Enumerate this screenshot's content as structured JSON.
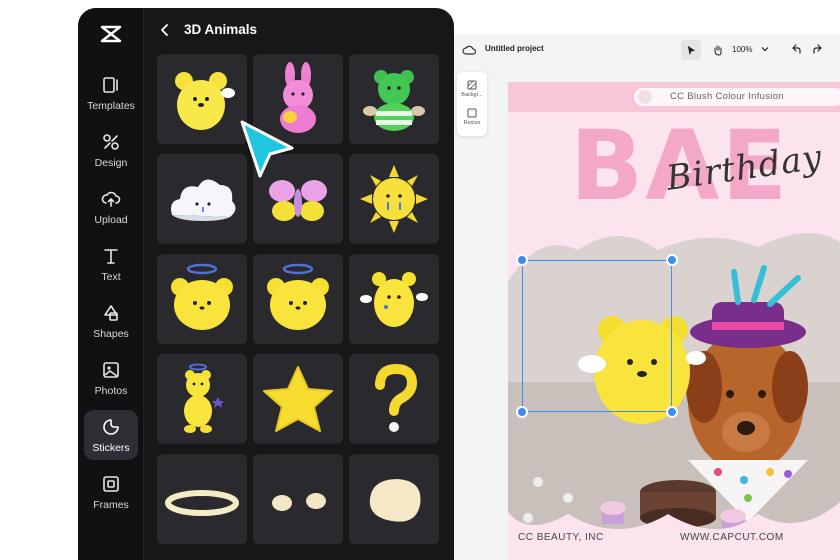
{
  "app": {
    "rail": [
      {
        "label": "Templates",
        "icon": "templates-icon"
      },
      {
        "label": "Design",
        "icon": "design-icon"
      },
      {
        "label": "Upload",
        "icon": "upload-icon"
      },
      {
        "label": "Text",
        "icon": "text-icon"
      },
      {
        "label": "Shapes",
        "icon": "shapes-icon"
      },
      {
        "label": "Photos",
        "icon": "photos-icon"
      },
      {
        "label": "Stickers",
        "icon": "stickers-icon",
        "active": true
      },
      {
        "label": "Frames",
        "icon": "frames-icon"
      }
    ],
    "panel_title": "3D Animals",
    "stickers": [
      "yellow-bear-sticker",
      "pink-bunny-sticker",
      "green-bear-sticker",
      "cloud-sticker",
      "butterfly-sticker",
      "sun-sticker",
      "halo-bear-sticker",
      "halo-bear-sticker-2",
      "winged-bear-sticker",
      "angel-bear-sticker",
      "star-sticker",
      "question-mark-sticker",
      "ring-sticker",
      "ears-sticker",
      "blob-sticker"
    ]
  },
  "editor": {
    "project_name": "Untitled project",
    "zoom": "100%",
    "side_tools": [
      {
        "label": "Backgr..."
      },
      {
        "label": "Resize"
      }
    ],
    "poster": {
      "search_text": "CC Blush Colour Infusion",
      "big_title": "BAE",
      "script_text": "Birthday",
      "footer_left": "CC BEAUTY, INC",
      "footer_right": "WWW.CAPCUT.COM"
    }
  },
  "colors": {
    "accent": "#3c8df0",
    "cursor": "#1fc6e0",
    "poster_pink": "#f4a8c8",
    "panel_bg": "#17171a"
  }
}
